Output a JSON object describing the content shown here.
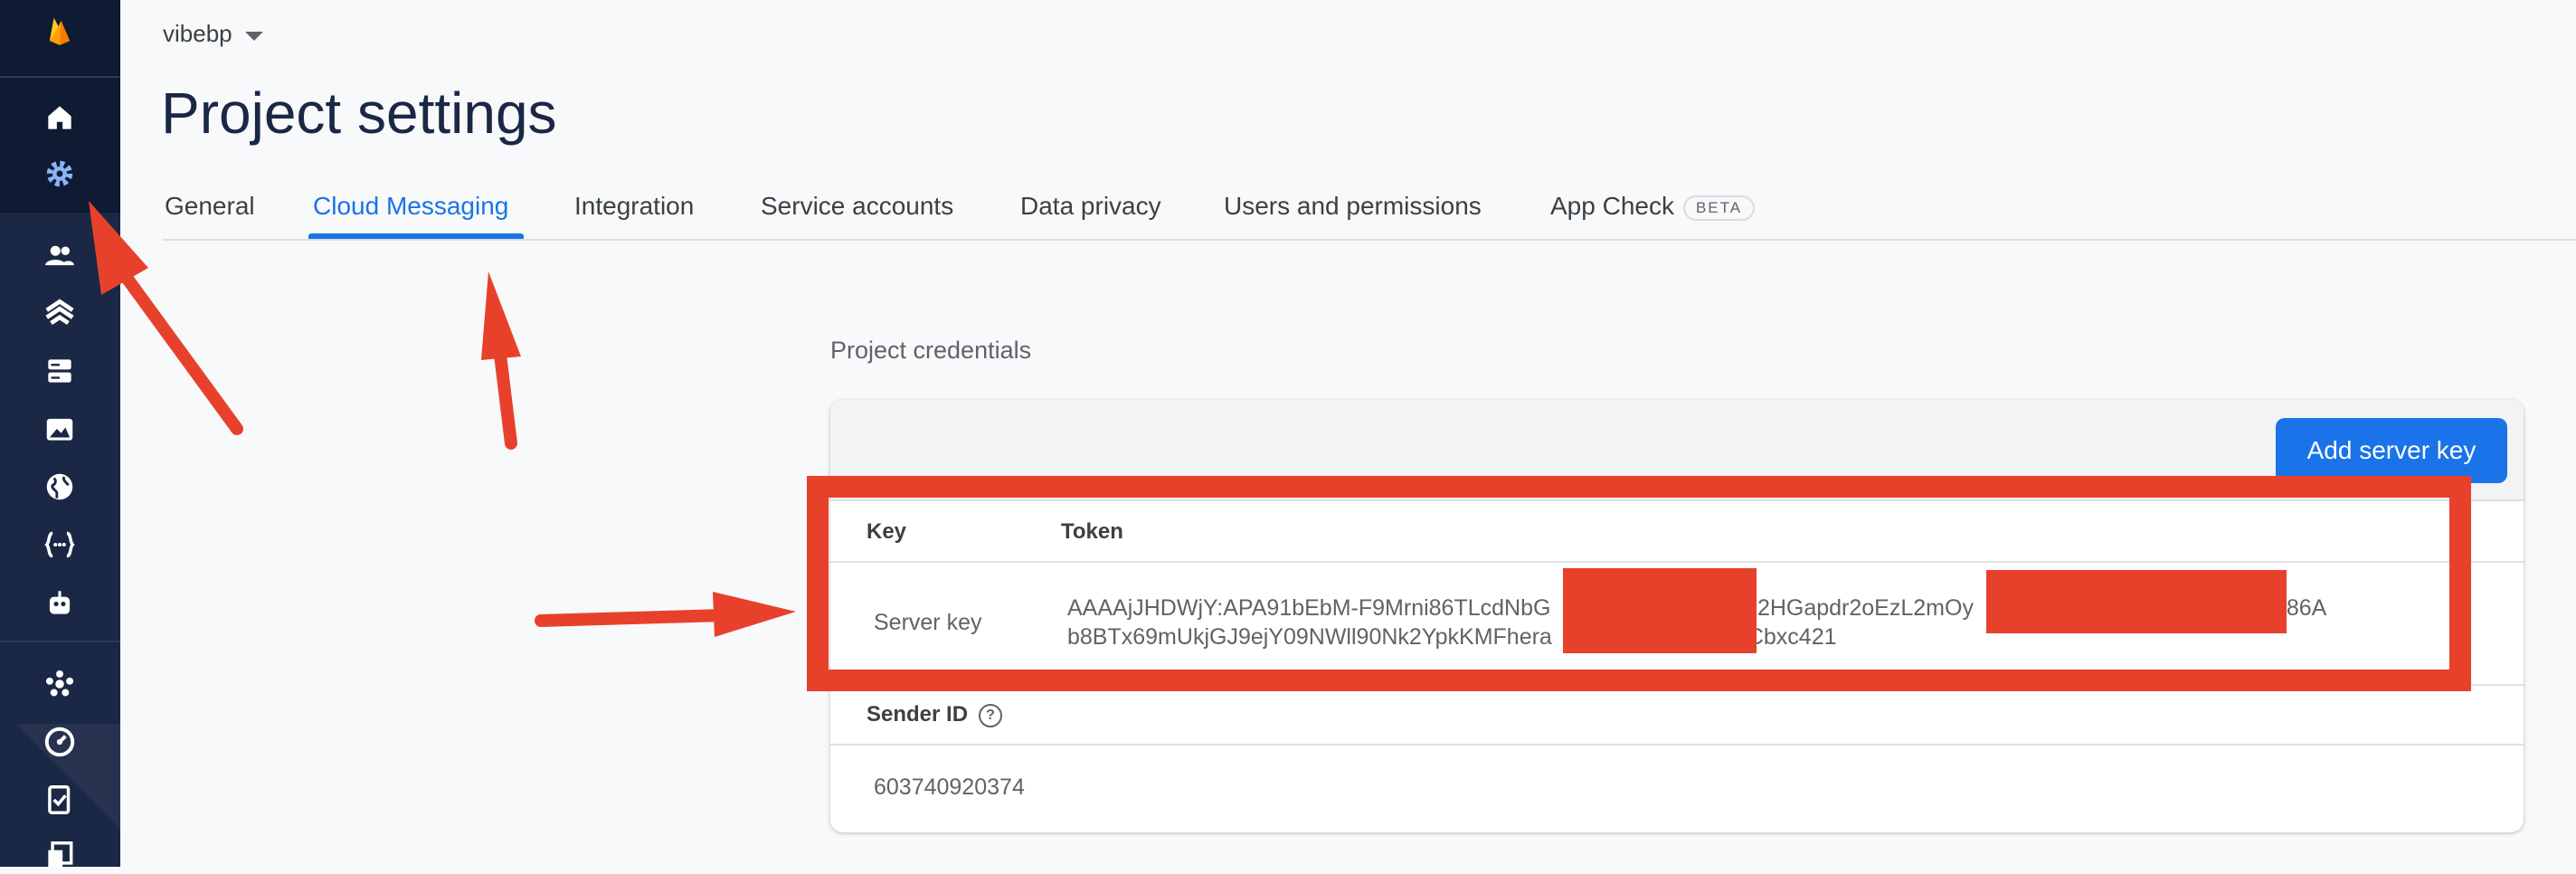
{
  "header": {
    "project_name": "vibebp",
    "page_title": "Project settings"
  },
  "tabs": [
    {
      "label": "General",
      "active": false
    },
    {
      "label": "Cloud Messaging",
      "active": true
    },
    {
      "label": "Integration",
      "active": false
    },
    {
      "label": "Service accounts",
      "active": false
    },
    {
      "label": "Data privacy",
      "active": false
    },
    {
      "label": "Users and permissions",
      "active": false
    },
    {
      "label": "App Check",
      "active": false,
      "badge": "BETA"
    }
  ],
  "sidebar": {
    "icons": [
      "firebase-logo-icon",
      "home-icon",
      "gear-icon",
      "users-icon",
      "layers-icon",
      "database-icon",
      "image-icon",
      "globe-icon",
      "functions-icon",
      "robot-icon",
      "crash-icon",
      "performance-icon",
      "checklist-icon",
      "more-icon"
    ]
  },
  "credentials": {
    "section_label": "Project credentials",
    "add_button": "Add server key",
    "columns": {
      "key": "Key",
      "token": "Token"
    },
    "server_key_label": "Server key",
    "token_line1_part1": "AAAAjJHDWjY:APA91bEbM-F9Mrni86TLcdNbG",
    "token_line1_part2": "J2HGapdr2oEzL2mOy",
    "token_line1_part3": "786A",
    "token_line2_part1": "b8BTx69mUkjGJ9ejY09NWll90Nk2YpkKMFhera",
    "token_line2_part2": "Cbxc421",
    "sender_id_label": "Sender ID",
    "sender_id_help": "?",
    "sender_id_value": "603740920374"
  },
  "colors": {
    "sidebar_bg": "#1a2745",
    "accent": "#1a73e8",
    "annotation_red": "#e8412b"
  }
}
